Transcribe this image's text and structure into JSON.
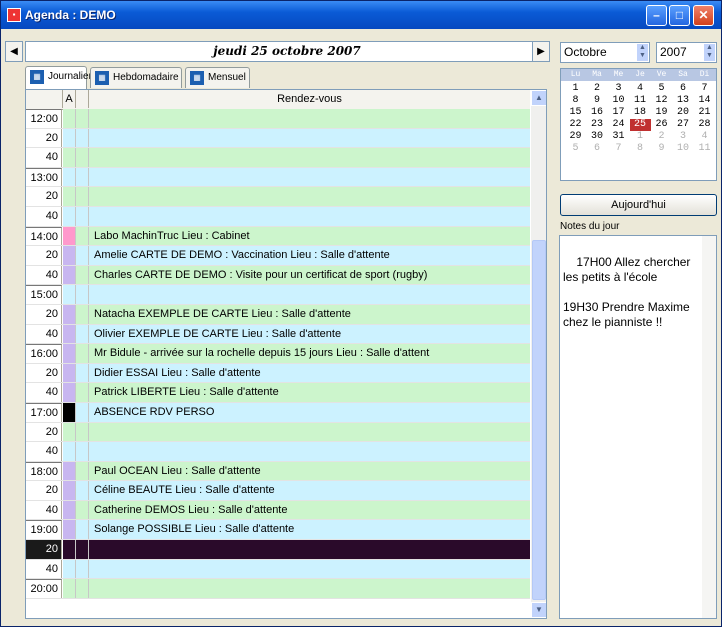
{
  "window": {
    "title": "Agenda : DEMO",
    "minimize": "–",
    "maximize": "□",
    "close": "✕"
  },
  "nav": {
    "prev": "◀",
    "next": "▶",
    "date": "jeudi 25 octobre 2007"
  },
  "tabs": [
    {
      "label": "Journalier",
      "icon": "day-view-icon",
      "active": true
    },
    {
      "label": "Hebdomadaire",
      "icon": "week-view-icon",
      "active": false
    },
    {
      "label": "Mensuel",
      "icon": "month-view-icon",
      "active": false
    }
  ],
  "grid": {
    "col_a": "A",
    "col_rv": "Rendez-vous",
    "rows": [
      {
        "time": "12:00",
        "hour": true,
        "bg": "#ccf5cc",
        "mark": "",
        "text": ""
      },
      {
        "time": "20",
        "hour": false,
        "bg": "#ccf2ff",
        "mark": "",
        "text": ""
      },
      {
        "time": "40",
        "hour": false,
        "bg": "#ccf5cc",
        "mark": "",
        "text": ""
      },
      {
        "time": "13:00",
        "hour": true,
        "bg": "#ccf2ff",
        "mark": "",
        "text": ""
      },
      {
        "time": "20",
        "hour": false,
        "bg": "#ccf5cc",
        "mark": "",
        "text": ""
      },
      {
        "time": "40",
        "hour": false,
        "bg": "#ccf2ff",
        "mark": "",
        "text": ""
      },
      {
        "time": "14:00",
        "hour": true,
        "bg": "#ccf5cc",
        "mark": "#ff99cc",
        "text": "Labo MachinTruc Lieu : Cabinet"
      },
      {
        "time": "20",
        "hour": false,
        "bg": "#ccf2ff",
        "mark": "#c8b6f0",
        "text": "Amelie CARTE DE DEMO : Vaccination Lieu : Salle d'attente"
      },
      {
        "time": "40",
        "hour": false,
        "bg": "#ccf5cc",
        "mark": "#c8b6f0",
        "text": "Charles CARTE DE DEMO : Visite pour un certificat de sport (rugby)"
      },
      {
        "time": "15:00",
        "hour": true,
        "bg": "#ccf2ff",
        "mark": "",
        "text": ""
      },
      {
        "time": "20",
        "hour": false,
        "bg": "#ccf5cc",
        "mark": "#c8b6f0",
        "text": "Natacha EXEMPLE DE CARTE Lieu : Salle d'attente"
      },
      {
        "time": "40",
        "hour": false,
        "bg": "#ccf2ff",
        "mark": "#c8b6f0",
        "text": "Olivier EXEMPLE DE CARTE Lieu : Salle d'attente"
      },
      {
        "time": "16:00",
        "hour": true,
        "bg": "#ccf5cc",
        "mark": "#c8b6f0",
        "text": "Mr Bidule - arrivée sur la rochelle depuis 15 jours Lieu : Salle d'attent"
      },
      {
        "time": "20",
        "hour": false,
        "bg": "#ccf2ff",
        "mark": "#c8b6f0",
        "text": "Didier ESSAI Lieu : Salle d'attente"
      },
      {
        "time": "40",
        "hour": false,
        "bg": "#ccf5cc",
        "mark": "#c8b6f0",
        "text": "Patrick LIBERTE Lieu : Salle d'attente"
      },
      {
        "time": "17:00",
        "hour": true,
        "bg": "#ccf2ff",
        "mark": "#000000",
        "text": "ABSENCE RDV PERSO"
      },
      {
        "time": "20",
        "hour": false,
        "bg": "#ccf5cc",
        "mark": "",
        "text": ""
      },
      {
        "time": "40",
        "hour": false,
        "bg": "#ccf2ff",
        "mark": "",
        "text": ""
      },
      {
        "time": "18:00",
        "hour": true,
        "bg": "#ccf5cc",
        "mark": "#c8b6f0",
        "text": "Paul OCEAN Lieu : Salle d'attente"
      },
      {
        "time": "20",
        "hour": false,
        "bg": "#ccf2ff",
        "mark": "#c8b6f0",
        "text": "Céline BEAUTE Lieu : Salle d'attente"
      },
      {
        "time": "40",
        "hour": false,
        "bg": "#ccf5cc",
        "mark": "#c8b6f0",
        "text": "Catherine DEMOS Lieu : Salle d'attente"
      },
      {
        "time": "19:00",
        "hour": true,
        "bg": "#ccf2ff",
        "mark": "#c8b6f0",
        "text": "Solange POSSIBLE Lieu : Salle d'attente"
      },
      {
        "time": "20",
        "hour": false,
        "bg": "#2a0a2a",
        "mark": "#2a0a2a",
        "text": "",
        "selected": true
      },
      {
        "time": "40",
        "hour": false,
        "bg": "#ccf2ff",
        "mark": "",
        "text": ""
      },
      {
        "time": "20:00",
        "hour": true,
        "bg": "#ccf5cc",
        "mark": "",
        "text": ""
      }
    ]
  },
  "month_combo": "Octobre",
  "year_combo": "2007",
  "calendar": {
    "headers": [
      "Lu",
      "Ma",
      "Me",
      "Je",
      "Ve",
      "Sa",
      "Di"
    ],
    "weeks": [
      [
        {
          "d": "1"
        },
        {
          "d": "2"
        },
        {
          "d": "3"
        },
        {
          "d": "4"
        },
        {
          "d": "5"
        },
        {
          "d": "6"
        },
        {
          "d": "7"
        }
      ],
      [
        {
          "d": "8"
        },
        {
          "d": "9"
        },
        {
          "d": "10"
        },
        {
          "d": "11"
        },
        {
          "d": "12"
        },
        {
          "d": "13"
        },
        {
          "d": "14"
        }
      ],
      [
        {
          "d": "15"
        },
        {
          "d": "16"
        },
        {
          "d": "17"
        },
        {
          "d": "18"
        },
        {
          "d": "19"
        },
        {
          "d": "20"
        },
        {
          "d": "21"
        }
      ],
      [
        {
          "d": "22"
        },
        {
          "d": "23"
        },
        {
          "d": "24"
        },
        {
          "d": "25",
          "today": true
        },
        {
          "d": "26"
        },
        {
          "d": "27"
        },
        {
          "d": "28"
        }
      ],
      [
        {
          "d": "29"
        },
        {
          "d": "30"
        },
        {
          "d": "31"
        },
        {
          "d": "1",
          "muted": true
        },
        {
          "d": "2",
          "muted": true
        },
        {
          "d": "3",
          "muted": true
        },
        {
          "d": "4",
          "muted": true
        }
      ],
      [
        {
          "d": "5",
          "muted": true
        },
        {
          "d": "6",
          "muted": true
        },
        {
          "d": "7",
          "muted": true
        },
        {
          "d": "8",
          "muted": true
        },
        {
          "d": "9",
          "muted": true
        },
        {
          "d": "10",
          "muted": true
        },
        {
          "d": "11",
          "muted": true
        }
      ]
    ]
  },
  "today_button": "Aujourd'hui",
  "notes": {
    "label": "Notes du jour",
    "text": "17H00 Allez chercher les petits à l'école\n\n19H30 Prendre Maxime chez le pianniste !!"
  }
}
